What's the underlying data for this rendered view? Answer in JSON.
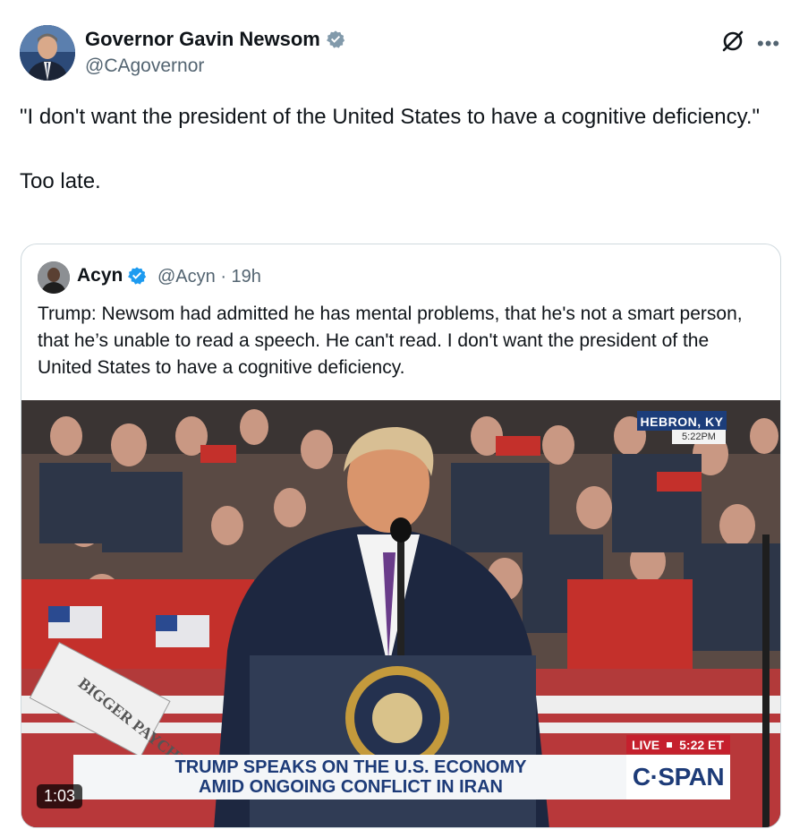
{
  "tweet": {
    "author_name": "Governor Gavin Newsom",
    "author_handle": "@CAgovernor",
    "verified_color": "#829aab",
    "text": "\"I don't want the president of the United States to have a cognitive deficiency.\"\n\nToo late."
  },
  "quote": {
    "author_name": "Acyn",
    "author_handle": "@Acyn · 19h",
    "verified_color": "#1d9bf0",
    "text": "Trump: Newsom had admitted he has mental problems, that he's not a smart person, that he’s unable to read a speech. He can't read. I don't want the president of the United States to have a cognitive deficiency.",
    "video": {
      "location": "HEBRON, KY",
      "location_time": "5:22PM",
      "live_label": "LIVE",
      "live_time": "5:22 ET",
      "headline_line1": "TRUMP SPEAKS ON THE U.S. ECONOMY",
      "headline_line2": "AMID ONGOING CONFLICT IN IRAN",
      "network": "C·SPAN",
      "duration": "1:03",
      "sign_text": "BIGGER PAYCHECKS"
    }
  }
}
